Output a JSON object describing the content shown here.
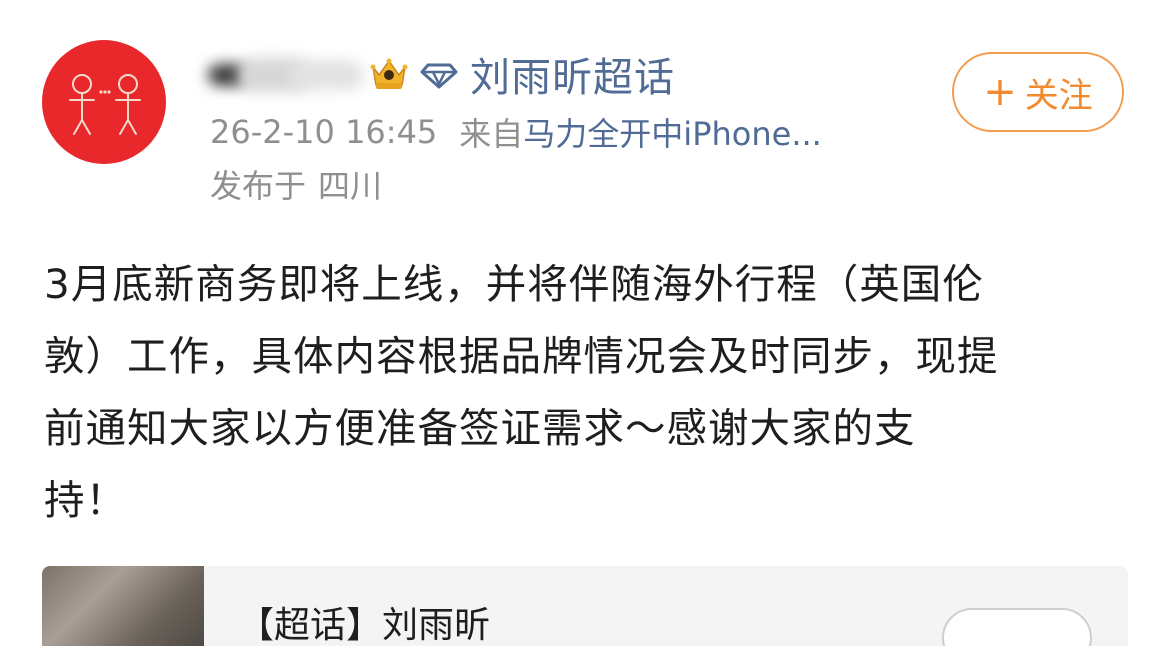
{
  "post": {
    "author_badge_icon": "crown-badge-icon",
    "topic_icon": "diamond-icon",
    "topic_name": "刘雨昕超话",
    "follow_label": "关注",
    "follow_plus": "+",
    "timestamp": "26-2-10 16:45",
    "source_prefix": "来自",
    "source_client": "马力全开中iPhone...",
    "location_prefix": "发布于",
    "location": "四川",
    "body_lines": [
      "3月底新商务即将上线，并将伴随海外行程（英国伦",
      "敦）工作，具体内容根据品牌情况会及时同步，现提",
      "前通知大家以方便准备签证需求～感谢大家的支",
      "持！"
    ]
  },
  "card": {
    "title": "【超话】刘雨昕"
  },
  "colors": {
    "link": "#4f6b96",
    "follow_accent": "#f28a2e",
    "avatar_bg": "#e8282b",
    "meta_gray": "#8f8f8f"
  }
}
